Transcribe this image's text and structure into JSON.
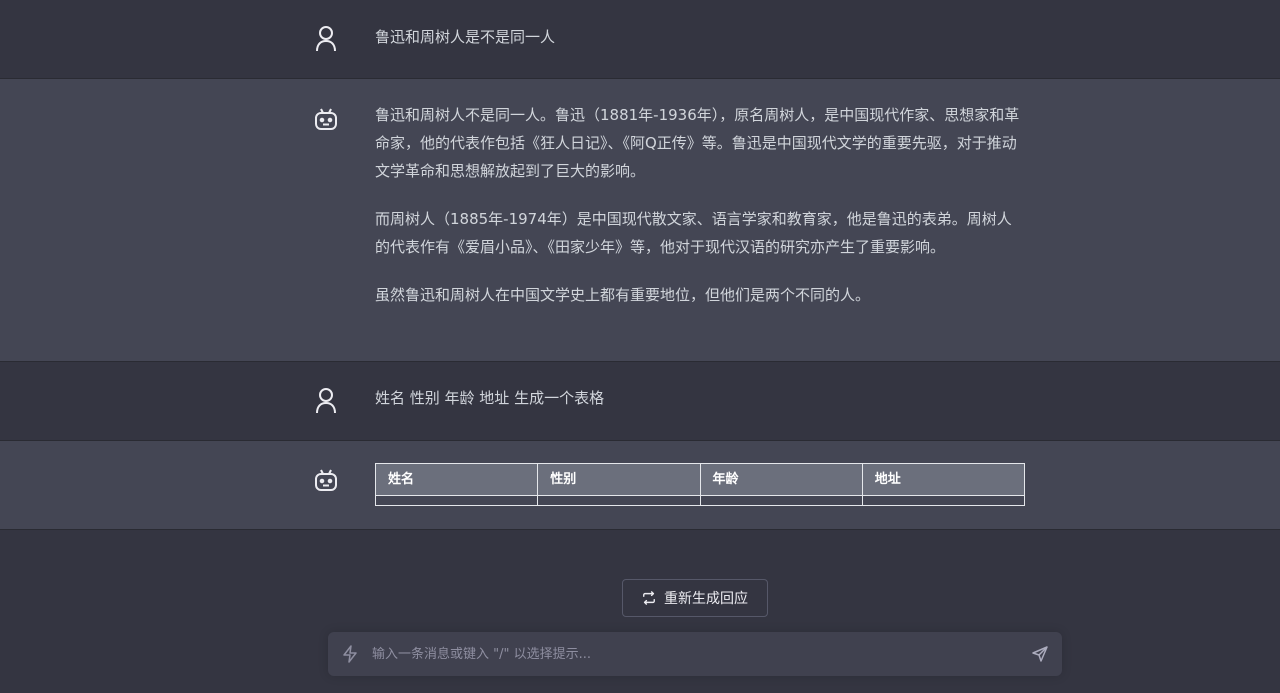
{
  "conversation": [
    {
      "role": "user",
      "text": "鲁迅和周树人是不是同一人"
    },
    {
      "role": "assistant",
      "paragraphs": [
        "鲁迅和周树人不是同一人。鲁迅（1881年-1936年），原名周树人，是中国现代作家、思想家和革命家，他的代表作包括《狂人日记》、《阿Q正传》等。鲁迅是中国现代文学的重要先驱，对于推动文学革命和思想解放起到了巨大的影响。",
        "而周树人（1885年-1974年）是中国现代散文家、语言学家和教育家，他是鲁迅的表弟。周树人的代表作有《爱眉小品》、《田家少年》等，他对于现代汉语的研究亦产生了重要影响。",
        "虽然鲁迅和周树人在中国文学史上都有重要地位，但他们是两个不同的人。"
      ]
    },
    {
      "role": "user",
      "text": "姓名 性别 年龄 地址 生成一个表格"
    },
    {
      "role": "assistant",
      "table": {
        "headers": [
          "姓名",
          "性别",
          "年龄",
          "地址"
        ],
        "rows": [
          [
            "",
            "",
            "",
            ""
          ]
        ]
      }
    }
  ],
  "regenerate_label": "重新生成回应",
  "input": {
    "placeholder": "输入一条消息或键入 \"/\" 以选择提示...",
    "value": ""
  },
  "icons": {
    "user_avatar": "user-icon",
    "bot_avatar": "robot-icon",
    "regenerate": "refresh-icon",
    "prompt": "bolt-icon",
    "send": "send-icon"
  }
}
